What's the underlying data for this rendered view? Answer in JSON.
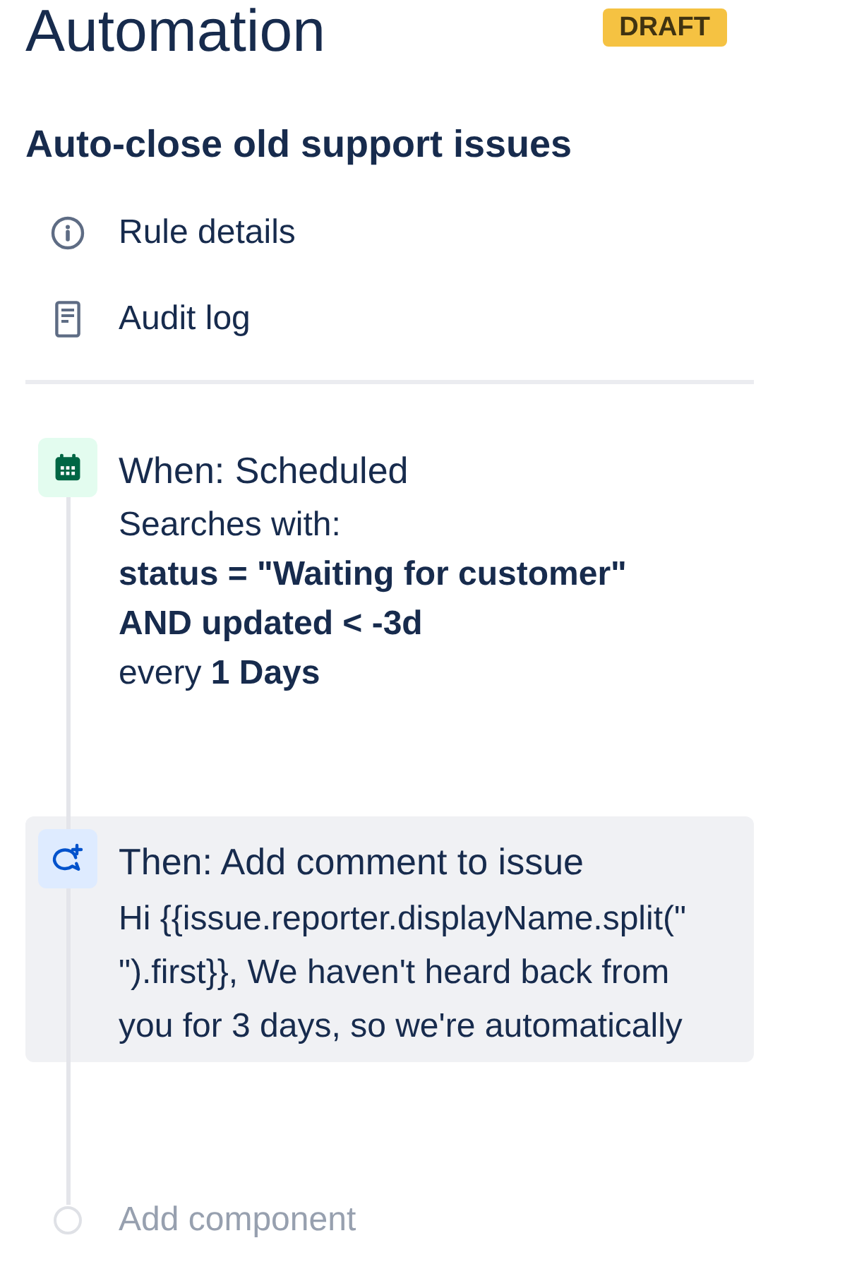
{
  "header": {
    "title": "Automation",
    "status_badge": "DRAFT"
  },
  "rule": {
    "name": "Auto-close old support issues"
  },
  "menu": [
    {
      "kind": "details",
      "label": "Rule details"
    },
    {
      "kind": "audit",
      "label": "Audit log"
    }
  ],
  "steps": [
    {
      "kind": "trigger",
      "selected": false,
      "title": "When: Scheduled",
      "description": "Searches with:",
      "query_lines": [
        "status = \"Waiting for customer\"",
        "AND updated < -3d"
      ],
      "schedule": "every **1 Days**"
    },
    {
      "kind": "action",
      "selected": true,
      "title": "Then: Add comment to issue",
      "comment_lines": [
        "Hi {{issue.reporter.displayName.split(\"",
        "\").first}}, We haven't heard back from",
        "you for 3 days, so we're automatically"
      ]
    }
  ],
  "add_component": {
    "label": "Add component"
  }
}
